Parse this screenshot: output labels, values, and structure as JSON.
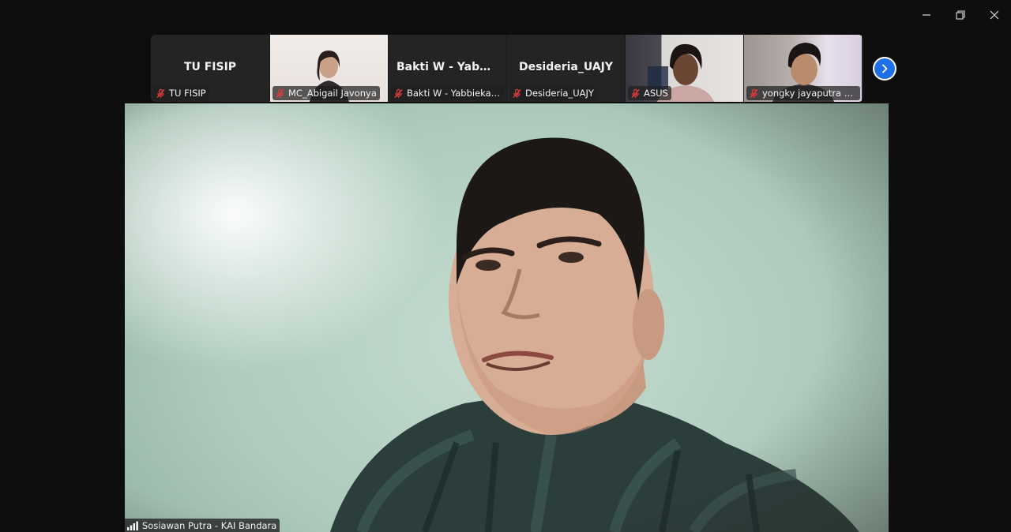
{
  "window": {
    "controls": [
      "minimize",
      "restore",
      "close"
    ]
  },
  "participants": [
    {
      "display_name": "TU FISIP",
      "label": "TU FISIP",
      "video": false,
      "muted": true
    },
    {
      "display_name": "",
      "label": "MC_Abigail Javonya",
      "video": true,
      "muted": true
    },
    {
      "display_name": "Bakti W - Yabbi...",
      "label": "Bakti W - Yabbiekayu",
      "video": false,
      "muted": true
    },
    {
      "display_name": "Desideria_UAJY",
      "label": "Desideria_UAJY",
      "video": false,
      "muted": true
    },
    {
      "display_name": "",
      "label": "ASUS",
      "video": true,
      "muted": true
    },
    {
      "display_name": "",
      "label": "yongky jayaputra ma...",
      "video": true,
      "muted": true
    }
  ],
  "active_speaker": {
    "label": "Sosiawan Putra - KAI Bandara"
  },
  "colors": {
    "background": "#0e0e0e",
    "tile": "#242424",
    "muted_icon": "#e23b3b",
    "accent_blue": "#1f6fe8"
  },
  "icons": {
    "minimize": "minimize-icon",
    "restore": "restore-icon",
    "close": "close-icon",
    "mic_muted": "mic-muted-icon",
    "next": "chevron-right-icon",
    "signal": "signal-bars-icon"
  }
}
